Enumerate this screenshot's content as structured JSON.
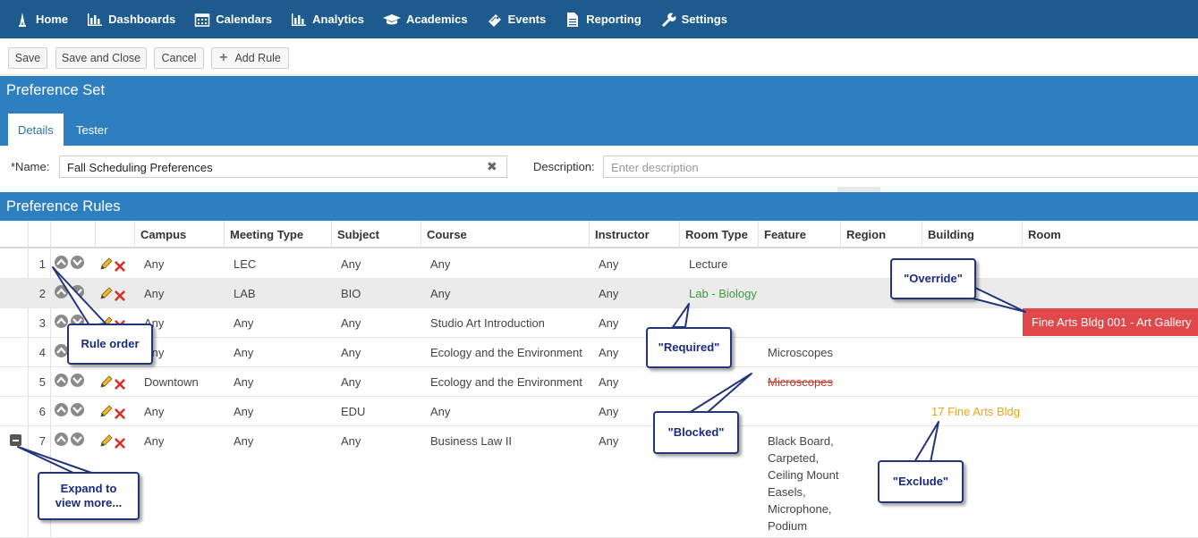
{
  "nav": {
    "items": [
      {
        "label": "Home",
        "icon": "tower-icon"
      },
      {
        "label": "Dashboards",
        "icon": "bar-chart-icon"
      },
      {
        "label": "Calendars",
        "icon": "calendar-icon"
      },
      {
        "label": "Analytics",
        "icon": "bar-chart-icon"
      },
      {
        "label": "Academics",
        "icon": "graduation-cap-icon"
      },
      {
        "label": "Events",
        "icon": "ticket-icon"
      },
      {
        "label": "Reporting",
        "icon": "document-icon"
      },
      {
        "label": "Settings",
        "icon": "wrench-icon"
      }
    ]
  },
  "toolbar": {
    "save": "Save",
    "save_close": "Save and Close",
    "cancel": "Cancel",
    "add_rule": "Add Rule"
  },
  "preference_set": {
    "title": "Preference Set",
    "tabs": [
      "Details",
      "Tester"
    ],
    "name_label": "*Name:",
    "name_value": "Fall Scheduling Preferences",
    "description_label": "Description:",
    "description_placeholder": "Enter description"
  },
  "rules": {
    "title": "Preference Rules",
    "columns": [
      "Campus",
      "Meeting Type",
      "Subject",
      "Course",
      "Instructor",
      "Room Type",
      "Feature",
      "Region",
      "Building",
      "Room"
    ],
    "rows": [
      {
        "n": "1",
        "campus": "Any",
        "meeting": "LEC",
        "subject": "Any",
        "course": "Any",
        "instructor": "Any",
        "room_type": "Lecture",
        "feature": "",
        "building": "",
        "room": ""
      },
      {
        "n": "2",
        "campus": "Any",
        "meeting": "LAB",
        "subject": "BIO",
        "course": "Any",
        "instructor": "Any",
        "room_type": "Lab - Biology",
        "feature": "",
        "building": "",
        "room": ""
      },
      {
        "n": "3",
        "campus": "Any",
        "meeting": "Any",
        "subject": "Any",
        "course": "Studio Art Introduction",
        "instructor": "Any",
        "room_type": "",
        "feature": "",
        "building": "",
        "room": "Fine Arts Bldg 001 - Art Gallery"
      },
      {
        "n": "4",
        "campus": "Any",
        "meeting": "Any",
        "subject": "Any",
        "course": "Ecology and the Environment",
        "instructor": "Any",
        "room_type": "",
        "feature": "Microscopes",
        "building": "",
        "room": ""
      },
      {
        "n": "5",
        "campus": "Downtown",
        "meeting": "Any",
        "subject": "Any",
        "course": "Ecology and the Environment",
        "instructor": "Any",
        "room_type": "",
        "feature": "Microscopes",
        "building": "",
        "room": ""
      },
      {
        "n": "6",
        "campus": "Any",
        "meeting": "Any",
        "subject": "EDU",
        "course": "Any",
        "instructor": "Any",
        "room_type": "",
        "feature": "",
        "building": "17 Fine Arts Bldg",
        "room": ""
      },
      {
        "n": "7",
        "campus": "Any",
        "meeting": "Any",
        "subject": "Any",
        "course": "Business Law II",
        "instructor": "Any",
        "room_type": "",
        "feature": "",
        "building": "",
        "room": ""
      }
    ],
    "row7_features": [
      "Black Board,",
      "Carpeted,",
      "Ceiling Mount",
      "Easels,",
      "Microphone,",
      "Podium"
    ]
  },
  "callouts": {
    "rule_order": "Rule order",
    "required": "\"Required\"",
    "override": "\"Override\"",
    "blocked": "\"Blocked\"",
    "exclude": "\"Exclude\"",
    "expand": "Expand to view more..."
  },
  "colors": {
    "nav_bg": "#1d5a8e",
    "section_bg": "#2d7fc0",
    "required_green": "#3d9a3d",
    "exclude_orange": "#f0a31a",
    "override_red": "#e0484b",
    "blocked_red": "#c0392b",
    "callout_navy": "#22347a"
  }
}
